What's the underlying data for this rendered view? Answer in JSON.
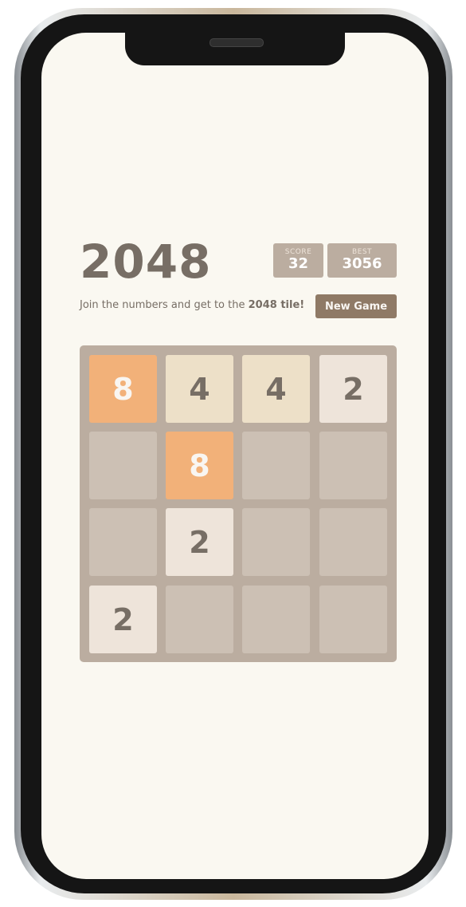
{
  "game": {
    "title": "2048",
    "score_label": "SCORE",
    "score_value": "32",
    "best_label": "BEST",
    "best_value": "3056",
    "intro_text": "Join the numbers and get to the ",
    "intro_bold": "2048 tile!",
    "new_game_label": "New Game"
  },
  "board": {
    "rows": [
      [
        "8",
        "4",
        "4",
        "2"
      ],
      [
        "",
        "8",
        "",
        ""
      ],
      [
        "",
        "2",
        "",
        ""
      ],
      [
        "2",
        "",
        "",
        ""
      ]
    ]
  },
  "tile_colors": {
    "2": {
      "bg": "#eee4da",
      "fg": "#776e65"
    },
    "4": {
      "bg": "#ede0c8",
      "fg": "#776e65"
    },
    "8": {
      "bg": "#f2b179",
      "fg": "#f9f6f2"
    }
  }
}
